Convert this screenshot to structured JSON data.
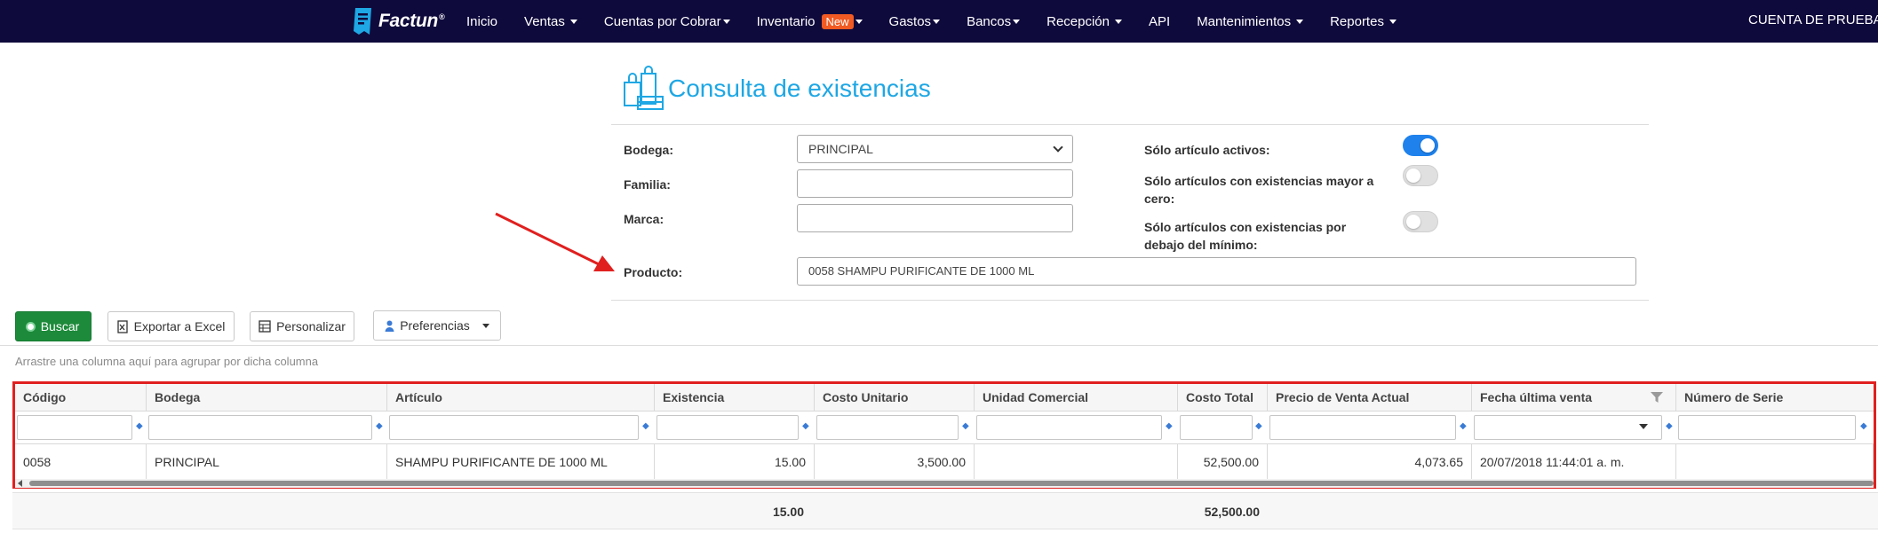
{
  "navbar": {
    "logo_text": "Factun",
    "logo_reg": "®",
    "items": [
      {
        "label": "Inicio",
        "dropdown": false
      },
      {
        "label": "Ventas",
        "dropdown": true
      },
      {
        "label": "Cuentas por Cobrar",
        "dropdown": true
      },
      {
        "label": "Inventario",
        "dropdown": true,
        "badge": "New"
      },
      {
        "label": "Gastos",
        "dropdown": true
      },
      {
        "label": "Bancos",
        "dropdown": true
      },
      {
        "label": "Recepción",
        "dropdown": true
      },
      {
        "label": "API",
        "dropdown": false
      },
      {
        "label": "Mantenimientos",
        "dropdown": true
      },
      {
        "label": "Reportes",
        "dropdown": true
      }
    ],
    "account": "CUENTA DE PRUEBAS"
  },
  "page": {
    "title": "Consulta de existencias"
  },
  "form": {
    "bodega_label": "Bodega:",
    "bodega_value": "PRINCIPAL",
    "familia_label": "Familia:",
    "familia_value": "",
    "marca_label": "Marca:",
    "marca_value": "",
    "producto_label": "Producto:",
    "producto_value": "0058 SHAMPU PURIFICANTE DE 1000 ML",
    "toggle_activos_label": "Sólo artículo activos:",
    "toggle_activos_on": true,
    "toggle_mayor_cero_label_1": "Sólo artículos con existencias mayor a",
    "toggle_mayor_cero_label_2": "cero:",
    "toggle_mayor_cero_on": false,
    "toggle_minimo_label_1": "Sólo artículos con existencias por",
    "toggle_minimo_label_2": "debajo del mínimo:",
    "toggle_minimo_on": false
  },
  "toolbar": {
    "buscar": "Buscar",
    "exportar": "Exportar a Excel",
    "personalizar": "Personalizar",
    "preferencias": "Preferencias"
  },
  "grid": {
    "group_hint": "Arrastre una columna aquí para agrupar por dicha columna",
    "columns": {
      "codigo": "Código",
      "bodega": "Bodega",
      "articulo": "Artículo",
      "existencia": "Existencia",
      "costo_unitario": "Costo Unitario",
      "unidad_comercial": "Unidad Comercial",
      "costo_total": "Costo Total",
      "precio_venta": "Precio de Venta Actual",
      "fecha_ultima_venta": "Fecha última venta",
      "numero_serie": "Número de Serie"
    },
    "rows": [
      {
        "codigo": "0058",
        "bodega": "PRINCIPAL",
        "articulo": "SHAMPU PURIFICANTE DE 1000 ML",
        "existencia": "15.00",
        "costo_unitario": "3,500.00",
        "unidad_comercial": "",
        "costo_total": "52,500.00",
        "precio_venta": "4,073.65",
        "fecha_ultima_venta": "20/07/2018 11:44:01 a. m.",
        "numero_serie": ""
      }
    ],
    "totals": {
      "existencia": "15.00",
      "costo_total": "52,500.00"
    }
  },
  "colors": {
    "navbar_bg": "#0f0a3c",
    "title": "#1ea7e4",
    "primary_button": "#1c8a3a",
    "toggle_on": "#1f82ec",
    "badge_new": "#f15a22",
    "highlight_frame": "#e0201f",
    "annotation_arrow": "#e0201f"
  }
}
